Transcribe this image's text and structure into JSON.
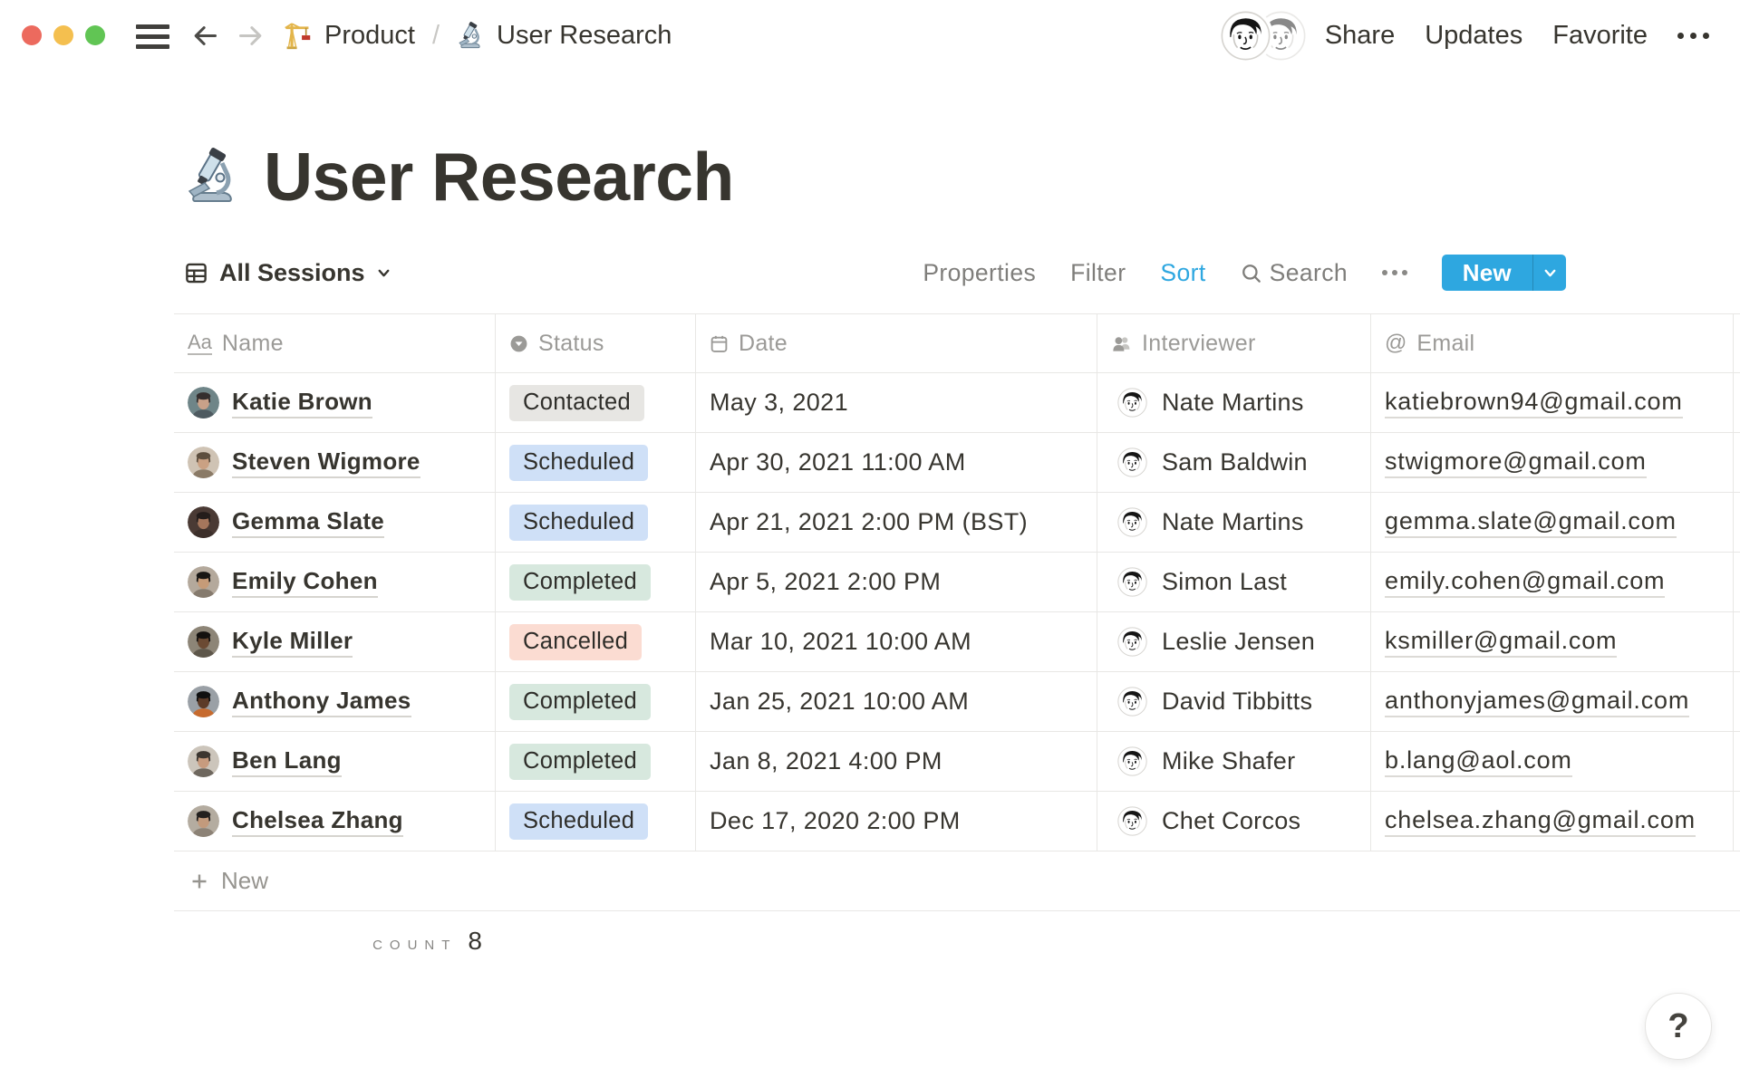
{
  "chrome": {
    "traffic_lights": {
      "close": "#ec6a5e",
      "minimize": "#f4bf4f",
      "zoom": "#61c554"
    },
    "breadcrumb": {
      "workspace_label": "Product",
      "separator": "/",
      "page_label": "User Research"
    },
    "topbar_actions": {
      "share": "Share",
      "updates": "Updates",
      "favorite": "Favorite"
    }
  },
  "page": {
    "title": "User Research",
    "icon": "microscope-emoji"
  },
  "view_bar": {
    "view_name": "All Sessions",
    "properties_label": "Properties",
    "filter_label": "Filter",
    "sort_label": "Sort",
    "search_label": "Search",
    "new_label": "New",
    "accent_color": "#2ea7e0",
    "sort_active_color": "#2ea7e0"
  },
  "table": {
    "columns": [
      {
        "label": "Name",
        "icon": "text-icon"
      },
      {
        "label": "Status",
        "icon": "select-icon"
      },
      {
        "label": "Date",
        "icon": "date-icon"
      },
      {
        "label": "Interviewer",
        "icon": "person-icon"
      },
      {
        "label": "Email",
        "icon": "email-icon"
      }
    ],
    "rows": [
      {
        "name": "Katie Brown",
        "status": "Contacted",
        "date": "May 3, 2021",
        "interviewer": "Nate Martins",
        "email": "katiebrown94@gmail.com",
        "avatar": {
          "bg": "#6f8588",
          "hair": "#342e2e",
          "skin": "#c9a189",
          "shirt": "#4e5a60"
        }
      },
      {
        "name": "Steven Wigmore",
        "status": "Scheduled",
        "date": "Apr 30, 2021 11:00 AM",
        "interviewer": "Sam Baldwin",
        "email": "stwigmore@gmail.com",
        "avatar": {
          "bg": "#cfc3b4",
          "hair": "#5d4f3f",
          "skin": "#caa183",
          "shirt": "#8a7a66"
        }
      },
      {
        "name": "Gemma Slate",
        "status": "Scheduled",
        "date": "Apr 21, 2021 2:00 PM (BST)",
        "interviewer": "Nate Martins",
        "email": "gemma.slate@gmail.com",
        "avatar": {
          "bg": "#4a3a34",
          "hair": "#241d1b",
          "skin": "#a5765c",
          "shirt": "#3c2f2a"
        }
      },
      {
        "name": "Emily Cohen",
        "status": "Completed",
        "date": "Apr 5, 2021 2:00 PM",
        "interviewer": "Simon Last",
        "email": "emily.cohen@gmail.com",
        "avatar": {
          "bg": "#b4a99c",
          "hair": "#191715",
          "skin": "#c69b78",
          "shirt": "#857a6d"
        }
      },
      {
        "name": "Kyle Miller",
        "status": "Cancelled",
        "date": "Mar 10, 2021 10:00 AM",
        "interviewer": "Leslie Jensen",
        "email": "ksmiller@gmail.com",
        "avatar": {
          "bg": "#8d8577",
          "hair": "#14110f",
          "skin": "#6b4a33",
          "shirt": "#5d564a"
        }
      },
      {
        "name": "Anthony James",
        "status": "Completed",
        "date": "Jan 25, 2021 10:00 AM",
        "interviewer": "David Tibbitts",
        "email": "anthonyjames@gmail.com",
        "avatar": {
          "bg": "#9aa0a6",
          "hair": "#101010",
          "skin": "#5c3b28",
          "shirt": "#c66a2e"
        }
      },
      {
        "name": "Ben Lang",
        "status": "Completed",
        "date": "Jan 8, 2021 4:00 PM",
        "interviewer": "Mike Shafer",
        "email": "b.lang@aol.com",
        "avatar": {
          "bg": "#ccc5bb",
          "hair": "#3c3630",
          "skin": "#c79b7e",
          "shirt": "#6e675e"
        }
      },
      {
        "name": "Chelsea Zhang",
        "status": "Scheduled",
        "date": "Dec 17, 2020 2:00 PM",
        "interviewer": "Chet Corcos",
        "email": "chelsea.zhang@gmail.com",
        "avatar": {
          "bg": "#b4aca0",
          "hair": "#23201e",
          "skin": "#c29a7c",
          "shirt": "#8c8276"
        }
      }
    ],
    "status_colors": {
      "Contacted": "#e7e6e3",
      "Scheduled": "#cfe0f7",
      "Completed": "#d7e8de",
      "Cancelled": "#fbdcd2"
    },
    "add_row_label": "New",
    "count_label": "COUNT",
    "count_value": "8"
  },
  "help_button": {
    "label": "?"
  }
}
